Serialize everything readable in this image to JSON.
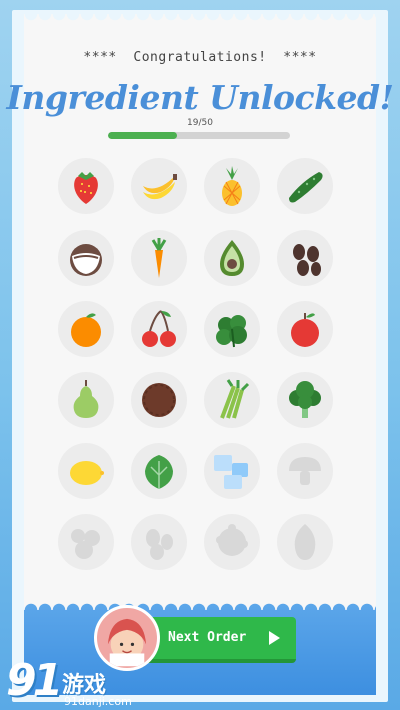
{
  "header": {
    "congrats": "****  Congratulations!  ****",
    "title": "Ingredient Unlocked!"
  },
  "progress": {
    "label": "19/50",
    "unlocked": 19,
    "total": 50,
    "color": "#4cb050"
  },
  "ingredients": [
    {
      "icon": "strawberry-icon",
      "unlocked": true
    },
    {
      "icon": "banana-icon",
      "unlocked": true
    },
    {
      "icon": "pineapple-icon",
      "unlocked": true
    },
    {
      "icon": "cucumber-icon",
      "unlocked": true
    },
    {
      "icon": "coconut-icon",
      "unlocked": true
    },
    {
      "icon": "carrot-icon",
      "unlocked": true
    },
    {
      "icon": "avocado-icon",
      "unlocked": true
    },
    {
      "icon": "coffee-beans-icon",
      "unlocked": true
    },
    {
      "icon": "orange-icon",
      "unlocked": true
    },
    {
      "icon": "cherries-icon",
      "unlocked": true
    },
    {
      "icon": "basil-icon",
      "unlocked": true
    },
    {
      "icon": "apple-icon",
      "unlocked": true
    },
    {
      "icon": "pear-icon",
      "unlocked": true
    },
    {
      "icon": "cookie-icon",
      "unlocked": true
    },
    {
      "icon": "celery-icon",
      "unlocked": true
    },
    {
      "icon": "broccoli-icon",
      "unlocked": true
    },
    {
      "icon": "lemon-icon",
      "unlocked": true
    },
    {
      "icon": "lettuce-icon",
      "unlocked": true
    },
    {
      "icon": "ice-cubes-icon",
      "unlocked": true
    },
    {
      "icon": "mushroom-icon",
      "unlocked": false
    },
    {
      "icon": "locked-ingredient-icon",
      "unlocked": false
    },
    {
      "icon": "locked-ingredient-icon",
      "unlocked": false
    },
    {
      "icon": "locked-ingredient-icon",
      "unlocked": false
    },
    {
      "icon": "locked-ingredient-icon",
      "unlocked": false
    }
  ],
  "button": {
    "label": "Next Order",
    "color": "#2fb84a"
  },
  "watermark": {
    "number": "91",
    "text": "游戏",
    "url": "91danji.com"
  },
  "colors": {
    "title": "#4a8fd8",
    "background": "#7cc2ec"
  }
}
